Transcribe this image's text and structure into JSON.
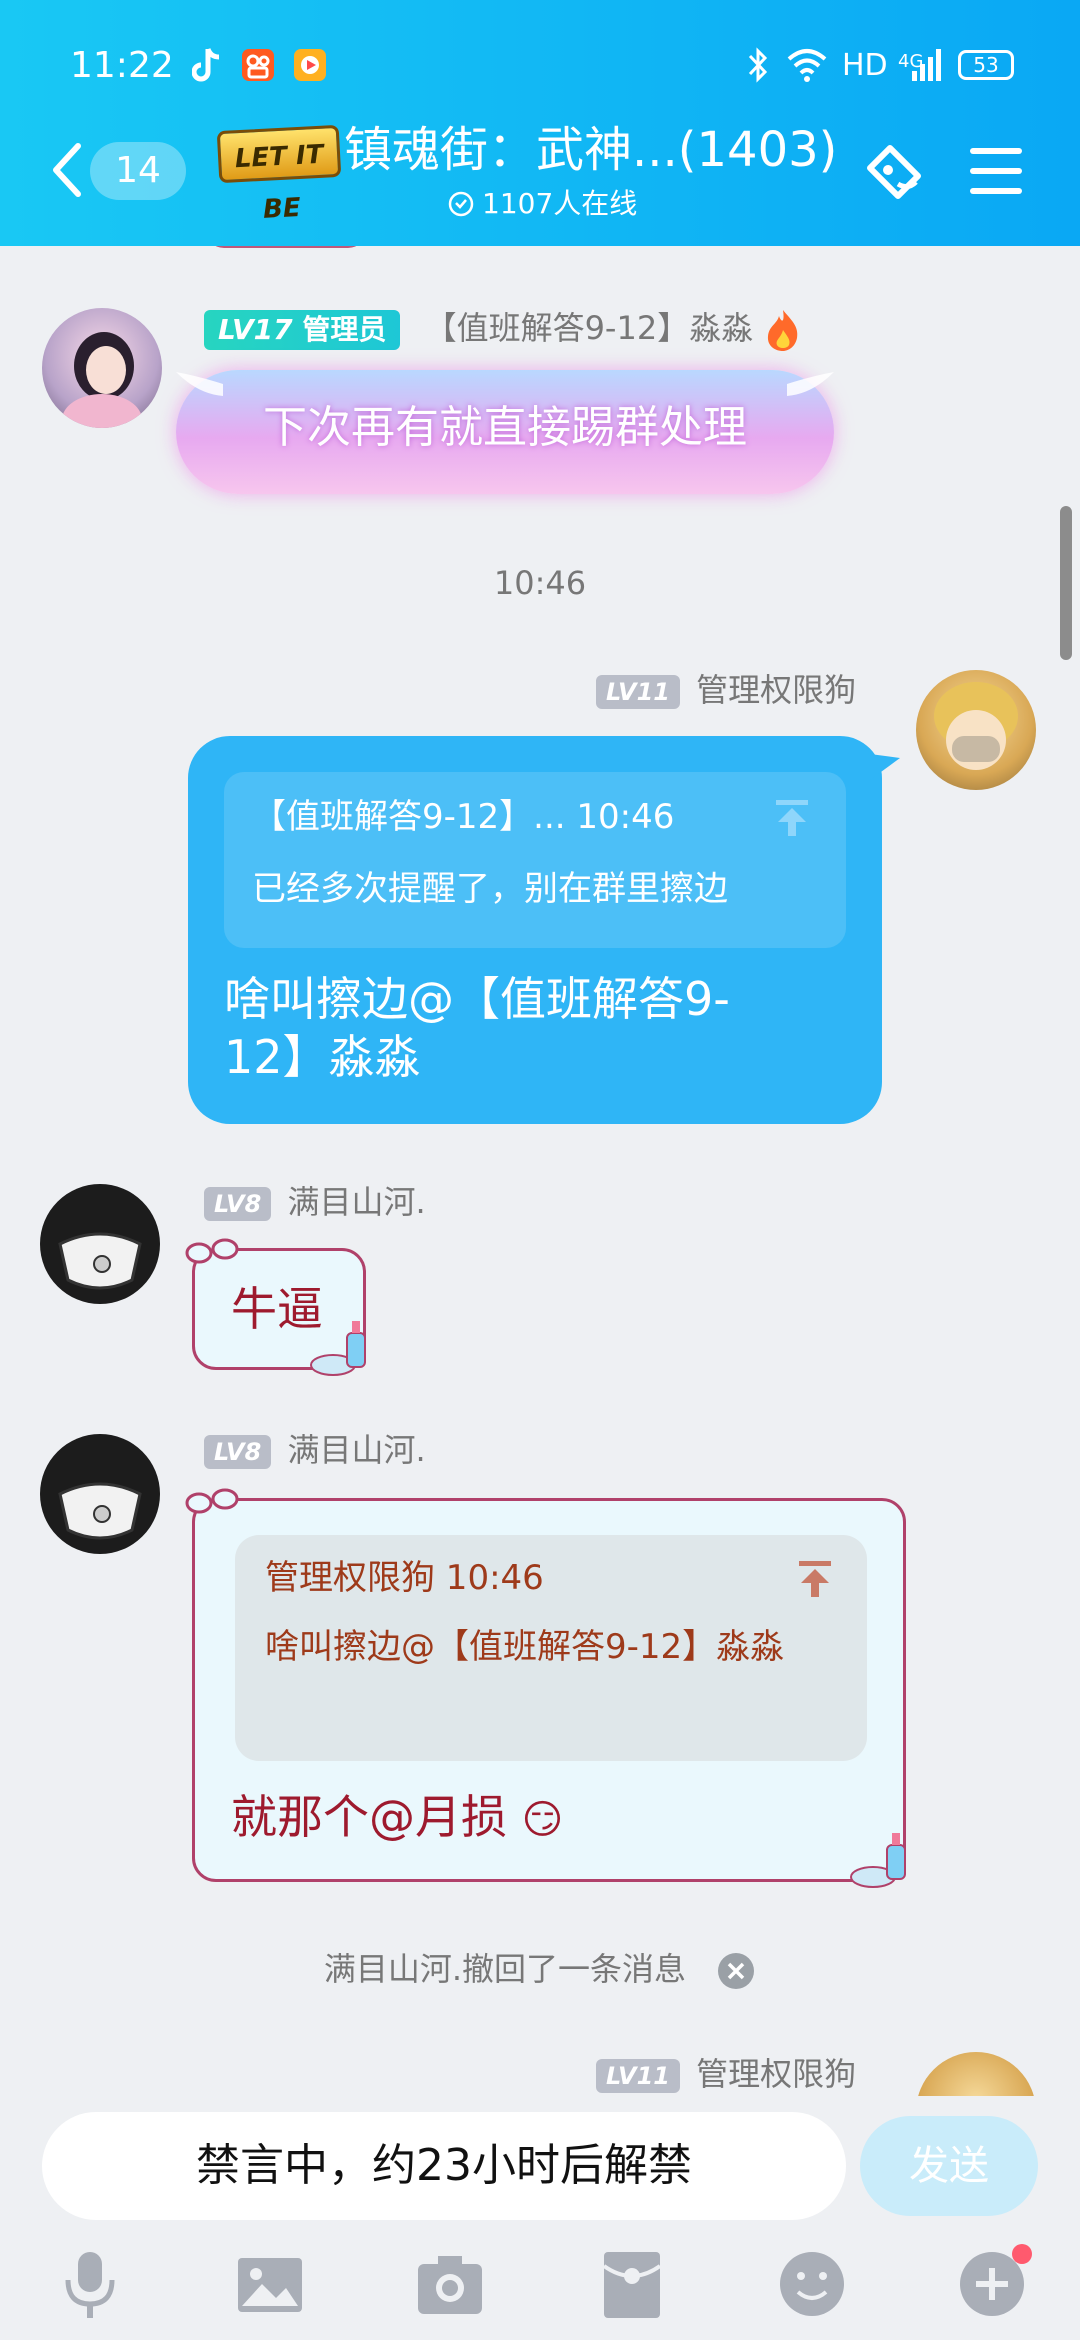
{
  "status_bar": {
    "time": "11:22",
    "network": "HD",
    "signal": "4G",
    "battery": "53"
  },
  "header": {
    "back_count": "14",
    "logo_text": "LET IT BE",
    "title": "镇魂街：武神...(1403)",
    "online": "1107人在线"
  },
  "messages": {
    "m1": {
      "level": "LV17",
      "role": "管理员",
      "sender": "【值班解答9-12】淼淼",
      "text": "下次再有就直接踢群处理"
    },
    "time_divider": "10:46",
    "m2": {
      "level": "LV11",
      "sender": "管理权限狗",
      "quote_header": "【值班解答9-12】... 10:46",
      "quote_text": "已经多次提醒了，别在群里擦边",
      "text": "啥叫擦边@【值班解答9-12】淼淼"
    },
    "m3": {
      "level": "LV8",
      "sender": "满目山河.",
      "text": "牛逼"
    },
    "m4": {
      "level": "LV8",
      "sender": "满目山河.",
      "quote_header": "管理权限狗 10:46",
      "quote_text": "啥叫擦边@【值班解答9-12】淼淼",
      "text": "就那个@月损",
      "emoji": "😏"
    },
    "recall_notice": "满目山河.撤回了一条消息",
    "m5": {
      "level": "LV11",
      "sender": "管理权限狗"
    }
  },
  "input_bar": {
    "mute_text": "禁言中，约23小时后解禁",
    "send_label": "发送"
  },
  "toolbar": {
    "items": [
      "mic-icon",
      "image-icon",
      "camera-icon",
      "red-packet-icon",
      "emoji-icon",
      "plus-icon"
    ]
  },
  "colors": {
    "header": "#13b6f4",
    "my_bubble": "#2fb5f6",
    "level_badge": "#b9bdc8",
    "admin_badge": "#27d5c0"
  }
}
